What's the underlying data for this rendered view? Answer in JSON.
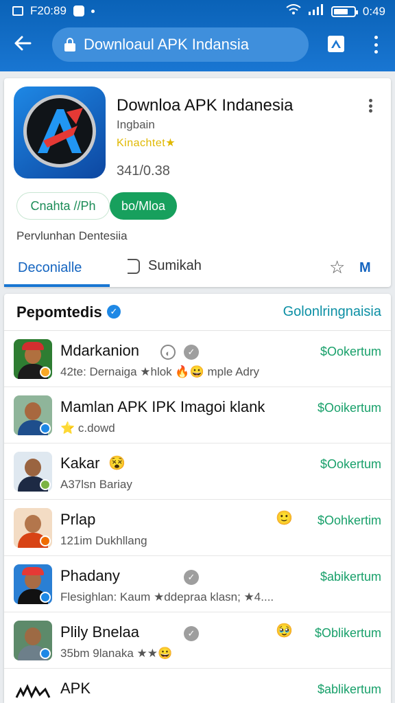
{
  "status": {
    "time_left": "F20:89",
    "time_right": "0:49",
    "battery_level_percent": 70
  },
  "toolbar": {
    "url_text": "Downloaul APK Indansia",
    "icons": [
      "back-arrow-icon",
      "lock-icon",
      "drive-icon",
      "more-vert-icon"
    ]
  },
  "app": {
    "title": "Downloa APK Indanesia",
    "developer": "Ingbain",
    "rating_text": "Kinachtet★",
    "size": "341/0.38",
    "outline_button": "Cnahta //Ph",
    "primary_button": "bo/Mloa",
    "description": "Pervlunhan Dentesiia",
    "tabs": {
      "tab1": "Deconialle",
      "tab2": "Sumikah",
      "tab3": "M"
    }
  },
  "list": {
    "title": "Pepomtedis",
    "link": "Golonlringnaisia",
    "rows": [
      {
        "name": "Mdarkanion",
        "sub": "42te: Dernaiga ★hlok 🔥😀 mple Adry",
        "action": "$Ookertum"
      },
      {
        "name": "Mamlan APK IPK Imagoi klank",
        "sub": "⭐ c.dowd",
        "action": "$Ooikertum"
      },
      {
        "name": "Kakar",
        "sub": "A37lsn Bariay",
        "action": "$Ookertum"
      },
      {
        "name": "Prlap",
        "sub": "121im Dukhllang",
        "action": "$Oohkertim"
      },
      {
        "name": "Phadany",
        "sub": "Flesighlan: Kaum ★ddepraa klasn; ★4....",
        "action": "$abikertum"
      },
      {
        "name": "Plily Bnelaa",
        "sub": "35bm 9lanaka ★★😀",
        "action": "$Oblikertum"
      },
      {
        "name": "APK",
        "sub": "",
        "action": "$ablikertum"
      }
    ]
  },
  "colors": {
    "topbar": "#1976d2",
    "accent_green": "#17a05d",
    "link_teal": "#0b8fa4"
  }
}
